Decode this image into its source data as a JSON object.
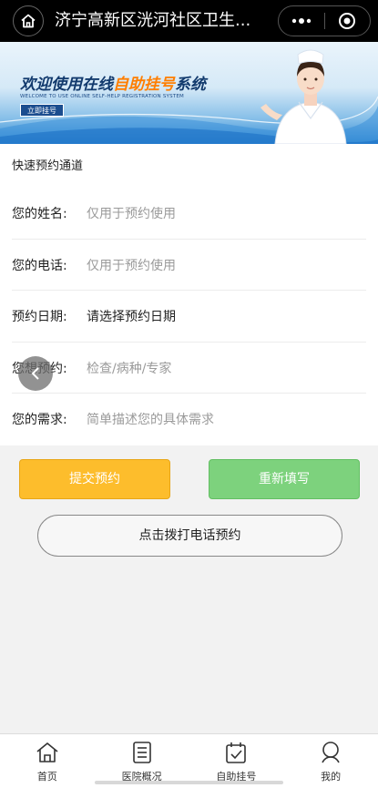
{
  "header": {
    "title": "济宁高新区洸河社区卫生...",
    "home_icon": "home-icon",
    "more_icon": "more-dots-icon",
    "close_icon": "target-circle-icon"
  },
  "banner": {
    "title_part1": "欢迎使用在线",
    "title_highlight": "自助挂号",
    "title_part2": "系统",
    "subtitle": "WELCOME TO USE ONLINE SELF-HELP REGISTRATION SYSTEM",
    "button_label": "立即挂号"
  },
  "form": {
    "section_title": "快速预约通道",
    "fields": [
      {
        "label": "您的姓名:",
        "placeholder": "仅用于预约使用"
      },
      {
        "label": "您的电话:",
        "placeholder": "仅用于预约使用"
      },
      {
        "label": "预约日期:",
        "value": "请选择预约日期"
      },
      {
        "label": "您想预约:",
        "placeholder": "检查/病种/专家"
      },
      {
        "label": "您的需求:",
        "placeholder": "简单描述您的具体需求"
      }
    ]
  },
  "actions": {
    "submit_label": "提交预约",
    "reset_label": "重新填写",
    "call_label": "点击拨打电话预约"
  },
  "tabbar": {
    "items": [
      {
        "label": "首页",
        "icon": "home-icon"
      },
      {
        "label": "医院概况",
        "icon": "document-list-icon"
      },
      {
        "label": "自助挂号",
        "icon": "calendar-check-icon"
      },
      {
        "label": "我的",
        "icon": "user-icon"
      }
    ]
  },
  "colors": {
    "submit": "#fdbd2c",
    "reset": "#7dd27d",
    "topbar": "#000000"
  }
}
